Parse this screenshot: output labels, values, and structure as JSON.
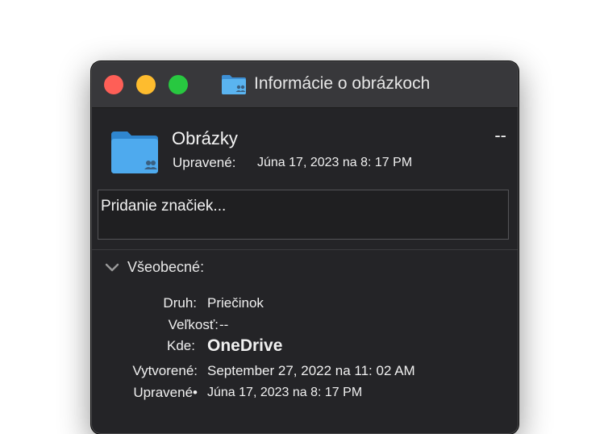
{
  "window": {
    "title": "Informácie o obrázkoch",
    "title_icon": "shared-folder-icon"
  },
  "item": {
    "name": "Obrázky",
    "size": "--",
    "modified_label": "Upravené:",
    "modified_value": "Júna 17, 2023 na 8: 17 PM",
    "icon": "shared-folder-icon"
  },
  "tags": {
    "placeholder": "Pridanie značiek..."
  },
  "general": {
    "header": "Všeobecné:",
    "rows": [
      {
        "label": "Druh:",
        "value": "Priečinok"
      },
      {
        "label": "Veľkosť:",
        "value": "--"
      },
      {
        "label": "Kde:",
        "value": "OneDrive"
      },
      {
        "label": "Vytvorené:",
        "value": "September 27, 2022 na 11: 02 AM"
      },
      {
        "label": "Upravené•",
        "value": "Júna 17, 2023 na 8: 17 PM"
      }
    ]
  },
  "colors": {
    "close": "#fe5f57",
    "minimize": "#febc2e",
    "zoom": "#28c840",
    "folder": "#4aa8ea",
    "window_bg": "#242427"
  }
}
